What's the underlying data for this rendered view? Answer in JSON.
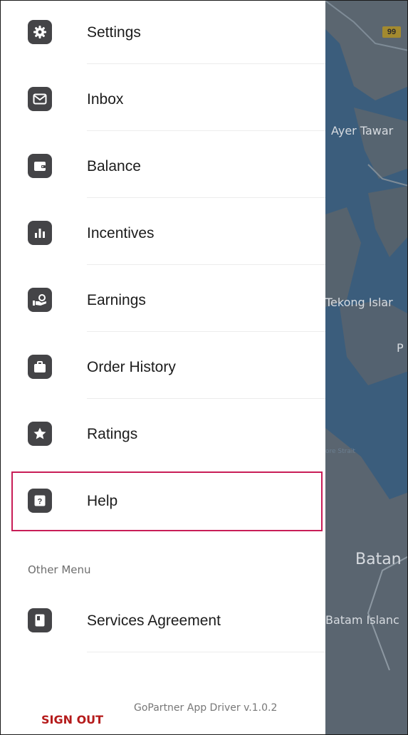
{
  "drawer": {
    "items": [
      {
        "label": "Settings",
        "icon": "gear-icon"
      },
      {
        "label": "Inbox",
        "icon": "envelope-icon"
      },
      {
        "label": "Balance",
        "icon": "wallet-icon"
      },
      {
        "label": "Incentives",
        "icon": "bar-chart-icon"
      },
      {
        "label": "Earnings",
        "icon": "hand-coin-icon"
      },
      {
        "label": "Order History",
        "icon": "briefcase-icon"
      },
      {
        "label": "Ratings",
        "icon": "star-icon"
      },
      {
        "label": "Help",
        "icon": "help-question-icon"
      }
    ],
    "other_menu_label": "Other Menu",
    "other_items": [
      {
        "label": "Services Agreement",
        "icon": "document-icon"
      }
    ],
    "sign_out_label": "SIGN OUT",
    "version_text": "GoPartner App Driver v.1.0.2"
  },
  "map": {
    "road_number": "99",
    "labels": [
      "Ayer Tawar",
      "Tekong Islar",
      "P",
      "ore Strait",
      "Batan",
      "Batam Islanc"
    ]
  },
  "colors": {
    "icon_bg": "#444447",
    "highlight": "#c81d57",
    "sign_out": "#b51b1b",
    "map_water": "#3b5d7c"
  }
}
